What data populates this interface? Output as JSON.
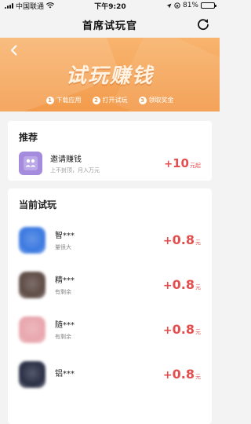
{
  "status_bar": {
    "carrier": "中国联通",
    "time": "下午9:20",
    "battery": "81%",
    "battery_level": 0.81
  },
  "nav": {
    "title": "首席试玩官"
  },
  "banner": {
    "title": "试玩赚钱",
    "steps": [
      {
        "num": "1",
        "label": "下载应用"
      },
      {
        "num": "2",
        "label": "打开试玩"
      },
      {
        "num": "3",
        "label": "领取奖金"
      }
    ],
    "bg_color": "#f39b4c"
  },
  "recommend": {
    "title": "推荐",
    "item": {
      "name": "邀请赚钱",
      "desc": "上不封顶，月入万元",
      "plus": "+",
      "amount": "10",
      "unit": "元起",
      "icon": "users-icon",
      "icon_color": "#a58bde"
    }
  },
  "current": {
    "title": "当前试玩",
    "items": [
      {
        "name": "智***",
        "desc": "量很大",
        "plus": "+",
        "amount": "0.8",
        "unit": "元",
        "icon_color": "#3b79e0"
      },
      {
        "name": "精***",
        "desc": "有剩余",
        "plus": "+",
        "amount": "0.8",
        "unit": "元",
        "icon_color": "#5e4b45"
      },
      {
        "name": "随***",
        "desc": "有剩余",
        "plus": "+",
        "amount": "0.8",
        "unit": "元",
        "icon_color": "#e8a6ad"
      },
      {
        "name": "铝***",
        "desc": "",
        "plus": "+",
        "amount": "0.8",
        "unit": "元",
        "icon_color": "#2a2f45"
      }
    ]
  },
  "accent_color": "#e44e4e"
}
